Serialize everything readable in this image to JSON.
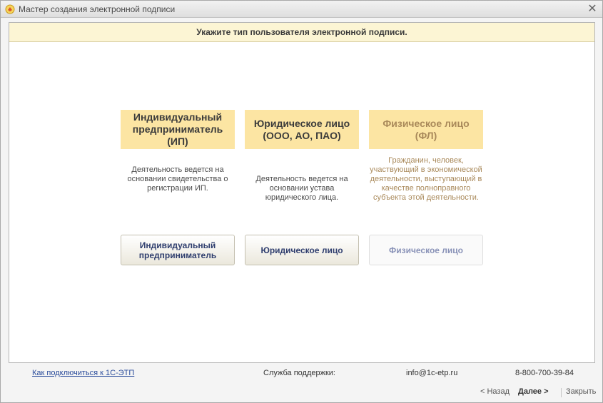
{
  "window": {
    "title": "Мастер создания электронной подписи",
    "close_glyph": "✕",
    "icon": "1c-app-icon"
  },
  "banner": {
    "text": "Укажите тип пользователя электронной подписи."
  },
  "options": [
    {
      "header": "Индивидуальный предприниматель (ИП)",
      "description": "Деятельность ведется на основании свидетельства о регистрации ИП.",
      "button": "Индивидуальный предприниматель",
      "enabled": true
    },
    {
      "header": "Юридическое лицо (ООО, АО, ПАО)",
      "description": "Деятельность ведется на основании устава юридического лица.",
      "button": "Юридическое лицо",
      "enabled": true
    },
    {
      "header": "Физическое лицо (ФЛ)",
      "description": "Гражданин, человек, участвующий в экономической деятельности, выступающий в качестве полноправного субъекта этой деятельности.",
      "button": "Физическое лицо",
      "enabled": false
    }
  ],
  "footer": {
    "connect_link": "Как подключиться к 1С-ЭТП",
    "support_label": "Служба поддержки:",
    "email": "info@1c-etp.ru",
    "phone": "8-800-700-39-84"
  },
  "navigation": {
    "back": "< Назад",
    "next": "Далее  >",
    "close": "Закрыть"
  },
  "colors": {
    "banner_bg": "#fcf5d4",
    "header_bg": "#fce5a3",
    "link": "#2a4c9b",
    "button_text": "#2f3e6e"
  }
}
